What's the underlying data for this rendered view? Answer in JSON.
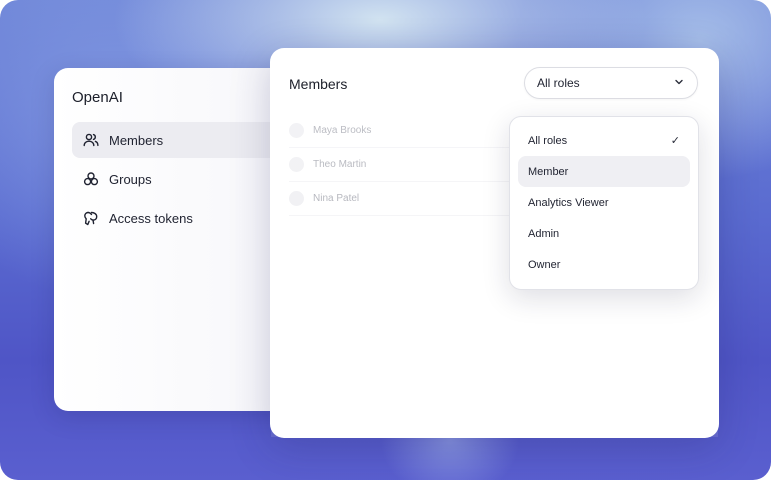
{
  "sidebar": {
    "brand": "OpenAI",
    "items": [
      {
        "label": "Members",
        "icon": "users-icon",
        "active": true
      },
      {
        "label": "Groups",
        "icon": "groups-icon",
        "active": false
      },
      {
        "label": "Access tokens",
        "icon": "access-token-icon",
        "active": false
      }
    ]
  },
  "main": {
    "title": "Members",
    "role_filter": {
      "value": "All roles"
    },
    "members": [
      {
        "name": "Maya Brooks"
      },
      {
        "name": "Theo Martin"
      },
      {
        "name": "Nina Patel"
      }
    ]
  },
  "dropdown": {
    "options": [
      {
        "label": "All roles",
        "selected": true,
        "check": "✓"
      },
      {
        "label": "Member",
        "selected": false,
        "highlighted": true
      },
      {
        "label": "Analytics Viewer",
        "selected": false
      },
      {
        "label": "Admin",
        "selected": false
      },
      {
        "label": "Owner",
        "selected": false
      }
    ]
  }
}
